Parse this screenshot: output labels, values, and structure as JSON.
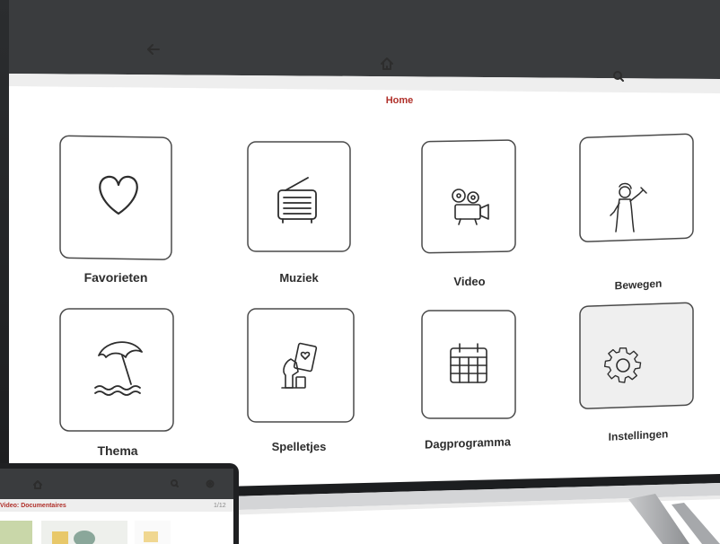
{
  "colors": {
    "accent": "#b0302a",
    "header": "#3a3c3e",
    "tile_border": "#4a4a4a"
  },
  "header": {
    "back_icon": "back-arrow-icon",
    "home_icon": "home-icon",
    "search_icon": "search-icon",
    "title": "Home"
  },
  "tiles": [
    {
      "label": "Favorieten",
      "icon": "heart-icon"
    },
    {
      "label": "Muziek",
      "icon": "radio-icon"
    },
    {
      "label": "Video",
      "icon": "film-projector-icon"
    },
    {
      "label": "Bewegen",
      "icon": "exercise-person-icon"
    },
    {
      "label": "Thema",
      "icon": "beach-umbrella-icon"
    },
    {
      "label": "Spelletjes",
      "icon": "games-chess-cards-icon"
    },
    {
      "label": "Dagprogramma",
      "icon": "calendar-icon"
    },
    {
      "label": "Instellingen",
      "icon": "gear-icon"
    }
  ],
  "tablet": {
    "title": "Video: Documentaires",
    "page": "1/12"
  }
}
